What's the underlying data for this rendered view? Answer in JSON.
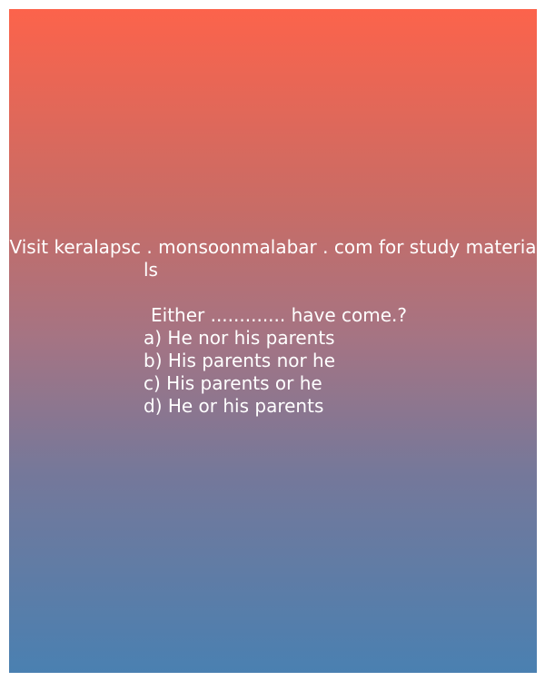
{
  "promo": {
    "line1": "Visit keralapsc . monsoonmalabar . com for study materia",
    "line2": "ls"
  },
  "question": {
    "text": "Either ............. have come.?"
  },
  "options": [
    {
      "label": "a)",
      "text": "He nor his parents"
    },
    {
      "label": "b)",
      "text": "His parents nor he"
    },
    {
      "label": "c)",
      "text": "His parents or he"
    },
    {
      "label": "d)",
      "text": "He or his parents"
    }
  ]
}
